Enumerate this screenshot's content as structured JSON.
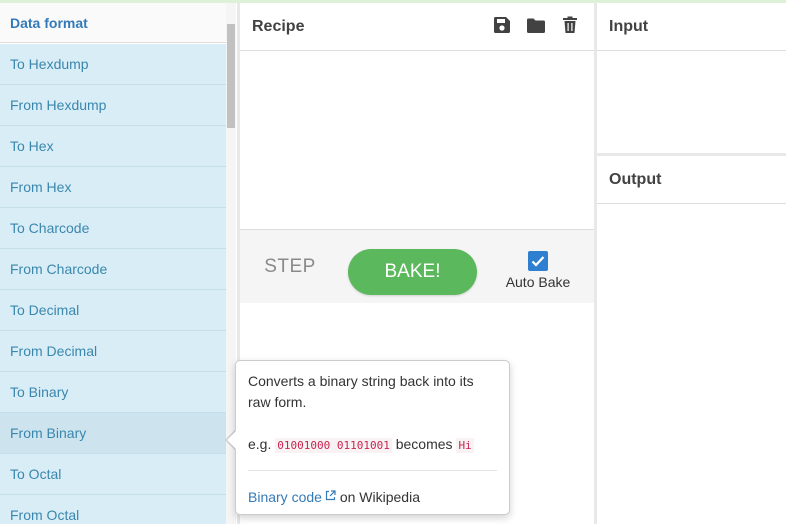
{
  "operations": {
    "category": "Data format",
    "items": [
      "To Hexdump",
      "From Hexdump",
      "To Hex",
      "From Hex",
      "To Charcode",
      "From Charcode",
      "To Decimal",
      "From Decimal",
      "To Binary",
      "From Binary",
      "To Octal",
      "From Octal"
    ],
    "hovered_item": "From Binary"
  },
  "recipe": {
    "title": "Recipe",
    "icons": [
      "save-icon",
      "folder-icon",
      "trash-icon"
    ],
    "step_label": "STEP",
    "bake_label": "BAKE!",
    "auto_bake_label": "Auto Bake",
    "auto_bake_checked": true
  },
  "input": {
    "title": "Input"
  },
  "output": {
    "title": "Output"
  },
  "popover": {
    "description": "Converts a binary string back into its raw form.",
    "example_prefix": "e.g.",
    "example_input": "01001000 01101001",
    "example_middle": "becomes",
    "example_output": "Hi",
    "link_text": "Binary code",
    "link_suffix": "on Wikipedia"
  },
  "colors": {
    "accent": "#337ab7",
    "op_background": "#d9edf7",
    "bake_button": "#5cb85c",
    "checkbox": "#2f7fd0",
    "topline": "#dff0d8"
  }
}
